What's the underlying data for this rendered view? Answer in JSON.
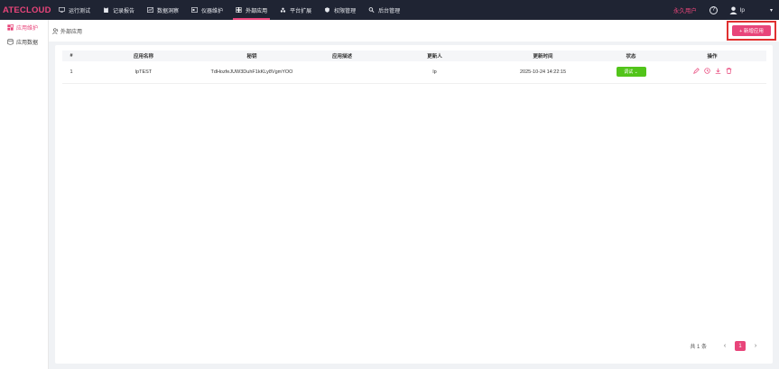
{
  "app": {
    "logo": "ATECLOUD"
  },
  "nav": {
    "items": [
      {
        "label": "运行测试",
        "icon": "monitor-icon"
      },
      {
        "label": "记录报告",
        "icon": "clipboard-icon"
      },
      {
        "label": "数据洞察",
        "icon": "chart-icon"
      },
      {
        "label": "仪器维护",
        "icon": "instrument-icon"
      },
      {
        "label": "外部应用",
        "icon": "apps-grid-icon",
        "active": true
      },
      {
        "label": "平台扩展",
        "icon": "extension-icon"
      },
      {
        "label": "权限管理",
        "icon": "shield-icon"
      },
      {
        "label": "后台管理",
        "icon": "settings-icon"
      }
    ]
  },
  "header": {
    "user_type": "永久用户",
    "help": "?",
    "username": "lp",
    "caret": "▾"
  },
  "sidebar": {
    "items": [
      {
        "label": "应用维护",
        "icon": "apps-icon",
        "active": true
      },
      {
        "label": "应用数据",
        "icon": "database-icon"
      }
    ]
  },
  "breadcrumb": {
    "label": "外部应用"
  },
  "toolbar": {
    "add_label": "+ 新增应用"
  },
  "table": {
    "columns": [
      "#",
      "应用名称",
      "秘钥",
      "应用描述",
      "更新人",
      "更新时间",
      "状态",
      "操作"
    ],
    "rows": [
      {
        "index": "1",
        "name": "lpTEST",
        "secret": "TdHozfeJUW3DuhF1kKLy8VgmYOO",
        "description": "",
        "updater": "lp",
        "updated_at": "2025-10-24 14:22:15",
        "status": "调试 ⌄"
      }
    ]
  },
  "pagination": {
    "total": "共 1 条",
    "prev": "‹",
    "page": "1",
    "next": "›"
  },
  "colors": {
    "accent": "#e8457a",
    "nav_bg": "#1f2433",
    "status_green": "#52c41a",
    "highlight_border": "#e03030"
  }
}
